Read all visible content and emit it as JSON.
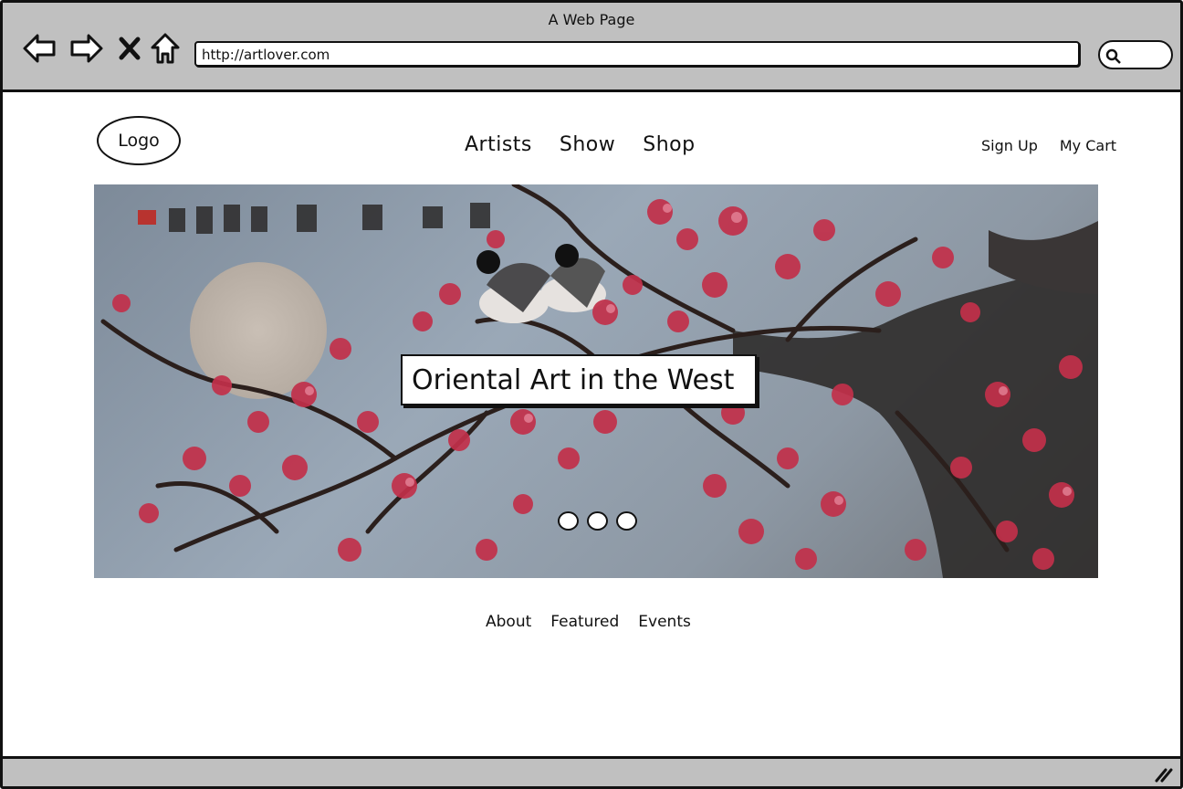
{
  "browser": {
    "title": "A Web Page",
    "url": "http://artlover.com",
    "icons": [
      "back-arrow-icon",
      "forward-arrow-icon",
      "stop-icon",
      "home-icon",
      "search-icon"
    ]
  },
  "header": {
    "logo": "Logo",
    "nav": [
      "Artists",
      "Show",
      "Shop"
    ],
    "user_links": [
      "Sign Up",
      "My Cart"
    ]
  },
  "hero": {
    "caption": "Oriental Art in the West",
    "slides": 3
  },
  "footer_nav": [
    "About",
    "Featured",
    "Events"
  ],
  "colors": {
    "chrome": "#c0c0c0",
    "border": "#111111",
    "blossom": "#c2304a"
  }
}
